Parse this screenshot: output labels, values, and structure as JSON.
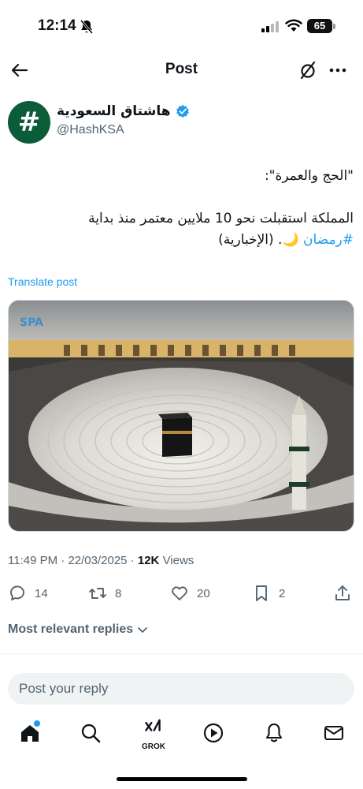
{
  "status_bar": {
    "time": "12:14",
    "battery": "65"
  },
  "nav": {
    "title": "Post"
  },
  "author": {
    "display_name": "هاشتاق السعودية",
    "handle": "@HashKSA",
    "avatar_glyph": "#"
  },
  "post": {
    "line1": "\"الحج والعمرة\":",
    "line2": "المملكة استقبلت نحو 10 ملايين معتمر منذ بداية",
    "hashtag": "#رمضان",
    "emoji": "🌙",
    "line3_rest": ". (الإخبارية)",
    "translate_label": "Translate post",
    "image_alt": "Masjid al-Haram, Kaaba surrounded by worshippers",
    "watermark": "واس SPA"
  },
  "meta": {
    "time": "11:49 PM",
    "date": "22/03/2025",
    "views_count": "12K",
    "views_label": "Views"
  },
  "actions": {
    "replies": "14",
    "reposts": "8",
    "likes": "20",
    "bookmarks": "2"
  },
  "replies": {
    "sort_label": "Most relevant replies"
  },
  "reply_box": {
    "placeholder": "Post your reply"
  },
  "tab_bar": {
    "grok_label": "GROK"
  },
  "colors": {
    "accent": "#1d9bf0",
    "text": "#0f1419",
    "muted": "#536471",
    "avatar_bg": "#0c5c3a"
  }
}
